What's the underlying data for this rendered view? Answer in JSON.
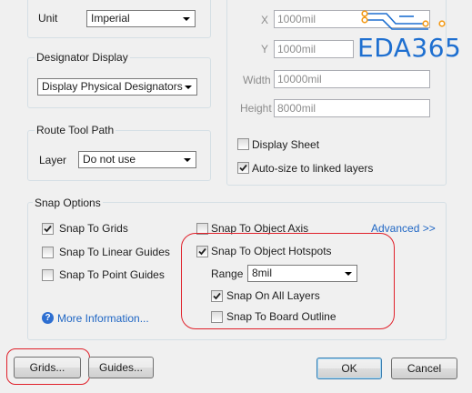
{
  "unit": {
    "label": "Unit",
    "value": "Imperial"
  },
  "designator_display": {
    "title": "Designator Display",
    "value": "Display Physical Designators"
  },
  "route_tool_path": {
    "title": "Route Tool Path",
    "layer_label": "Layer",
    "layer_value": "Do not use"
  },
  "sheet": {
    "x_label": "X",
    "x_value": "1000mil",
    "y_label": "Y",
    "y_value": "1000mil",
    "width_label": "Width",
    "width_value": "10000mil",
    "height_label": "Height",
    "height_value": "8000mil",
    "display_sheet": {
      "label": "Display Sheet",
      "checked": false
    },
    "auto_size": {
      "label": "Auto-size to linked layers",
      "checked": true
    }
  },
  "snap_options": {
    "title": "Snap Options",
    "snap_to_grids": {
      "label": "Snap To Grids",
      "checked": true
    },
    "snap_to_linear_guides": {
      "label": "Snap To Linear Guides",
      "checked": false
    },
    "snap_to_point_guides": {
      "label": "Snap To Point Guides",
      "checked": false
    },
    "snap_to_object_axis": {
      "label": "Snap To Object Axis",
      "checked": false
    },
    "snap_to_object_hotspots": {
      "label": "Snap To Object Hotspots",
      "checked": true
    },
    "range_label": "Range",
    "range_value": "8mil",
    "snap_on_all_layers": {
      "label": "Snap On All Layers",
      "checked": true
    },
    "snap_to_board_outline": {
      "label": "Snap To Board Outline",
      "checked": false
    },
    "advanced_link": "Advanced >>",
    "more_info_link": "More Information..."
  },
  "buttons": {
    "grids": "Grids...",
    "guides": "Guides...",
    "ok": "OK",
    "cancel": "Cancel"
  },
  "watermark": {
    "text": "EDA365"
  },
  "colors": {
    "annotation_red": "#e0202a",
    "watermark_blue": "#1e6fd0",
    "link_blue": "#1f66c4"
  }
}
